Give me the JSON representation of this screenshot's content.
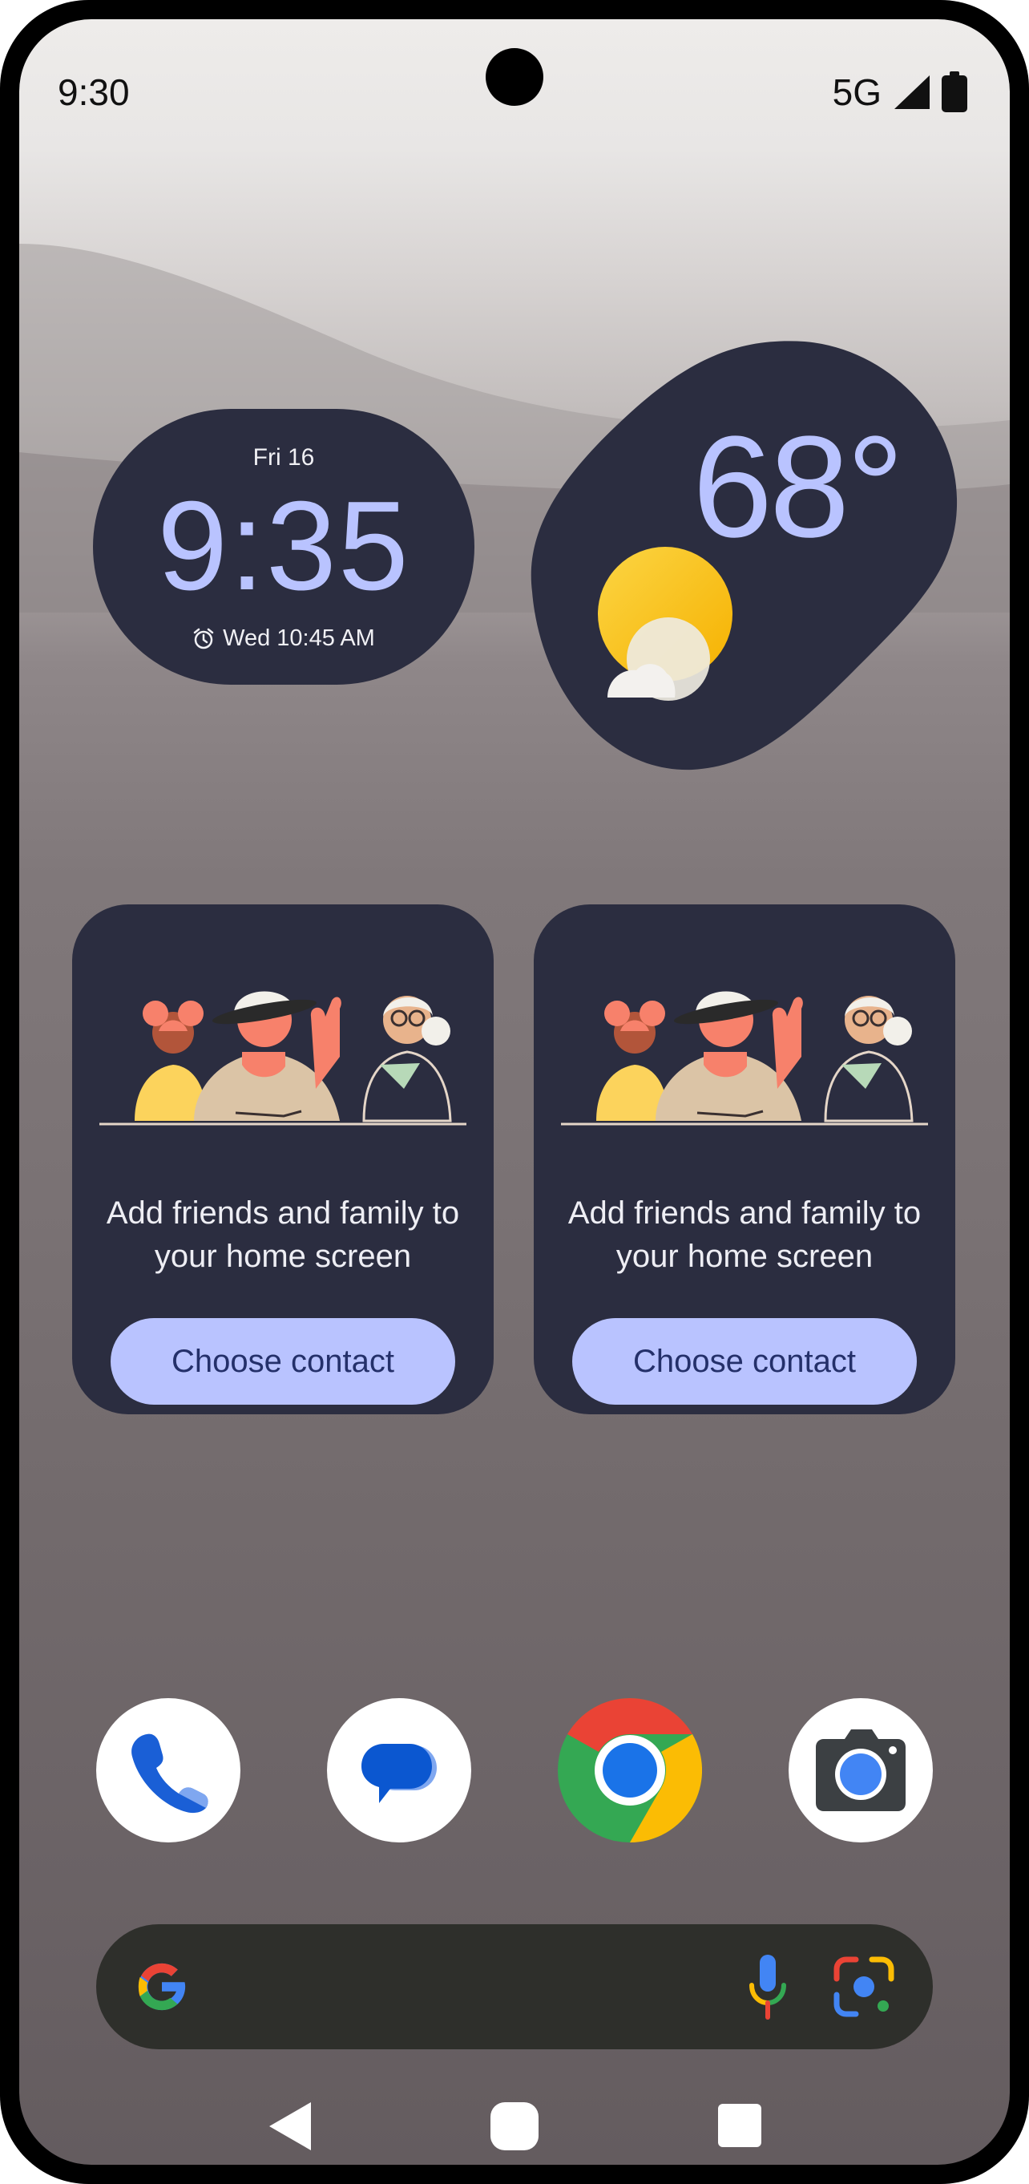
{
  "status_bar": {
    "time": "9:30",
    "network": "5G"
  },
  "clock_widget": {
    "date": "Fri 16",
    "time": "9:35",
    "alarm": "Wed 10:45 AM"
  },
  "weather_widget": {
    "temperature": "68°",
    "condition_icon": "sun-cloud-icon"
  },
  "contact_widgets": [
    {
      "message": "Add friends and family to your home screen",
      "button": "Choose contact"
    },
    {
      "message": "Add friends and family to your home screen",
      "button": "Choose contact"
    }
  ],
  "dock": [
    {
      "app": "Phone",
      "icon": "phone-icon"
    },
    {
      "app": "Messages",
      "icon": "messages-icon"
    },
    {
      "app": "Chrome",
      "icon": "chrome-icon"
    },
    {
      "app": "Camera",
      "icon": "camera-icon"
    }
  ],
  "search_bar": {
    "icons": [
      "google-g-icon",
      "microphone-icon",
      "lens-icon"
    ]
  },
  "navigation": [
    "back",
    "home",
    "recents"
  ],
  "colors": {
    "widget_bg": "#2b2d40",
    "accent": "#b9c3ff",
    "search_bg": "#2e2f2b"
  }
}
